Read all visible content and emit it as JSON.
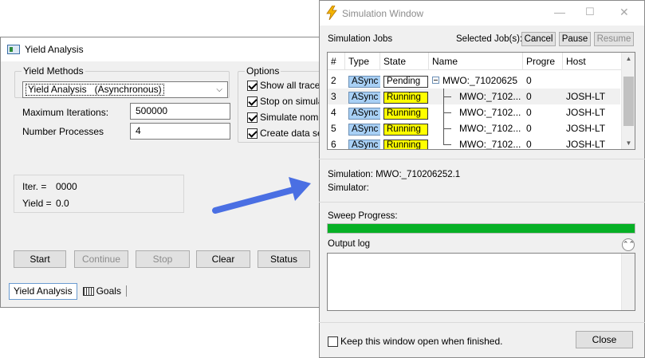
{
  "yield_window": {
    "title": "Yield Analysis",
    "yield_methods": {
      "group_label": "Yield Methods",
      "selected": "Yield Analysis   (Asynchronous)"
    },
    "max_iterations": {
      "label": "Maximum Iterations:",
      "value": "500000"
    },
    "num_processes": {
      "label": "Number Processes",
      "value": "4"
    },
    "options": {
      "group_label": "Options",
      "items": [
        {
          "label": "Show all trace u",
          "checked": true
        },
        {
          "label": "Stop on simulati",
          "checked": true
        },
        {
          "label": "Simulate nomina",
          "checked": true
        },
        {
          "label": "Create data set",
          "checked": true
        }
      ]
    },
    "status_panel": {
      "iter_label": "Iter. =",
      "iter_value": "0000",
      "yield_label": "Yield =",
      "yield_value": "0.0"
    },
    "buttons": {
      "start": "Start",
      "continue": "Continue",
      "stop": "Stop",
      "clear": "Clear",
      "status": "Status"
    },
    "tabs": {
      "yield_analysis": "Yield Analysis",
      "goals": "Goals"
    }
  },
  "arrow_color": "#4a6fe3",
  "sim_window": {
    "title": "Simulation Window",
    "jobs_label": "Simulation Jobs",
    "selected_jobs_label": "Selected Job(s):",
    "buttons": {
      "cancel": "Cancel",
      "pause": "Pause",
      "resume": "Resume",
      "close": "Close"
    },
    "table": {
      "headers": [
        "#",
        "Type",
        "State",
        "Name",
        "Progre",
        "Host"
      ],
      "rows": [
        {
          "num": "2",
          "type": "ASync",
          "state": "Pending",
          "name": "MWO:_71020625",
          "progress": "0",
          "host": "",
          "tree": "root"
        },
        {
          "num": "3",
          "type": "ASync",
          "state": "Running",
          "name": "MWO:_7102...",
          "progress": "0",
          "host": "JOSH-LT",
          "tree": "child"
        },
        {
          "num": "4",
          "type": "ASync",
          "state": "Running",
          "name": "MWO:_7102...",
          "progress": "0",
          "host": "JOSH-LT",
          "tree": "child"
        },
        {
          "num": "5",
          "type": "ASync",
          "state": "Running",
          "name": "MWO:_7102...",
          "progress": "0",
          "host": "JOSH-LT",
          "tree": "child"
        },
        {
          "num": "6",
          "type": "ASync",
          "state": "Running",
          "name": "MWO:_7102...",
          "progress": "0",
          "host": "JOSH-LT",
          "tree": "last"
        }
      ]
    },
    "simulation_line": "Simulation: MWO:_710206252.1",
    "simulator_line": "Simulator:",
    "sweep_progress_label": "Sweep Progress:",
    "sweep_progress_fraction": 1.0,
    "output_log_label": "Output log",
    "output_log_text": "",
    "keep_open_label": "Keep this window open when finished.",
    "keep_open_checked": false
  },
  "colors": {
    "running": "#ffff00",
    "async_badge": "#a8d0f5",
    "progress_green": "#06b025"
  }
}
